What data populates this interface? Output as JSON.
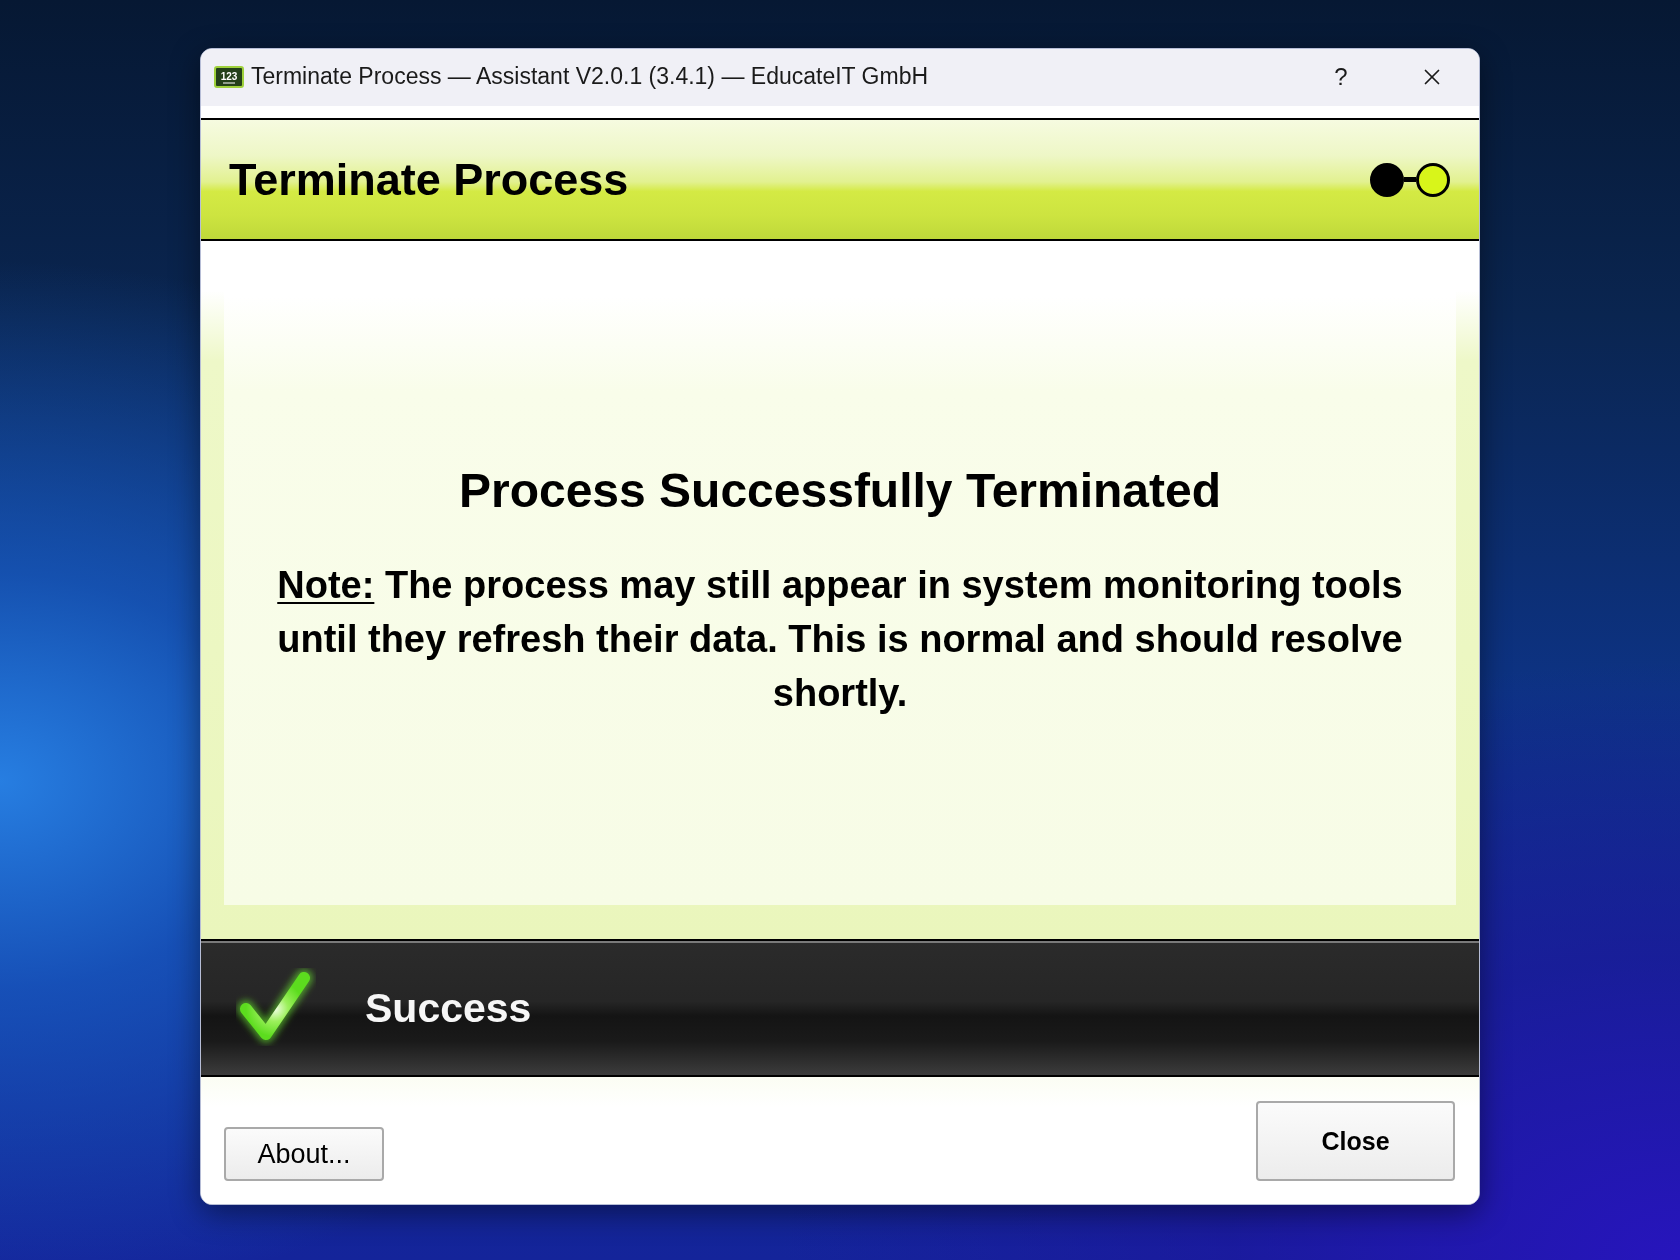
{
  "window": {
    "icon_label": "123",
    "title": "Terminate Process — Assistant V2.0.1 (3.4.1) — EducateIT GmbH",
    "help_label": "?"
  },
  "header": {
    "title": "Terminate Process",
    "steps": [
      {
        "selected": false
      },
      {
        "selected": true
      }
    ]
  },
  "content": {
    "heading": "Process Successfully Terminated",
    "note": {
      "label": "Note:",
      "text": "The process may still appear in system monitoring tools until they refresh their data. This is normal and should resolve shortly."
    }
  },
  "status_bar": {
    "kind": "success",
    "label": "Success"
  },
  "buttons": [
    {
      "label": "About...",
      "kind": "secondary"
    },
    {
      "label": "Close",
      "kind": "default"
    }
  ]
}
